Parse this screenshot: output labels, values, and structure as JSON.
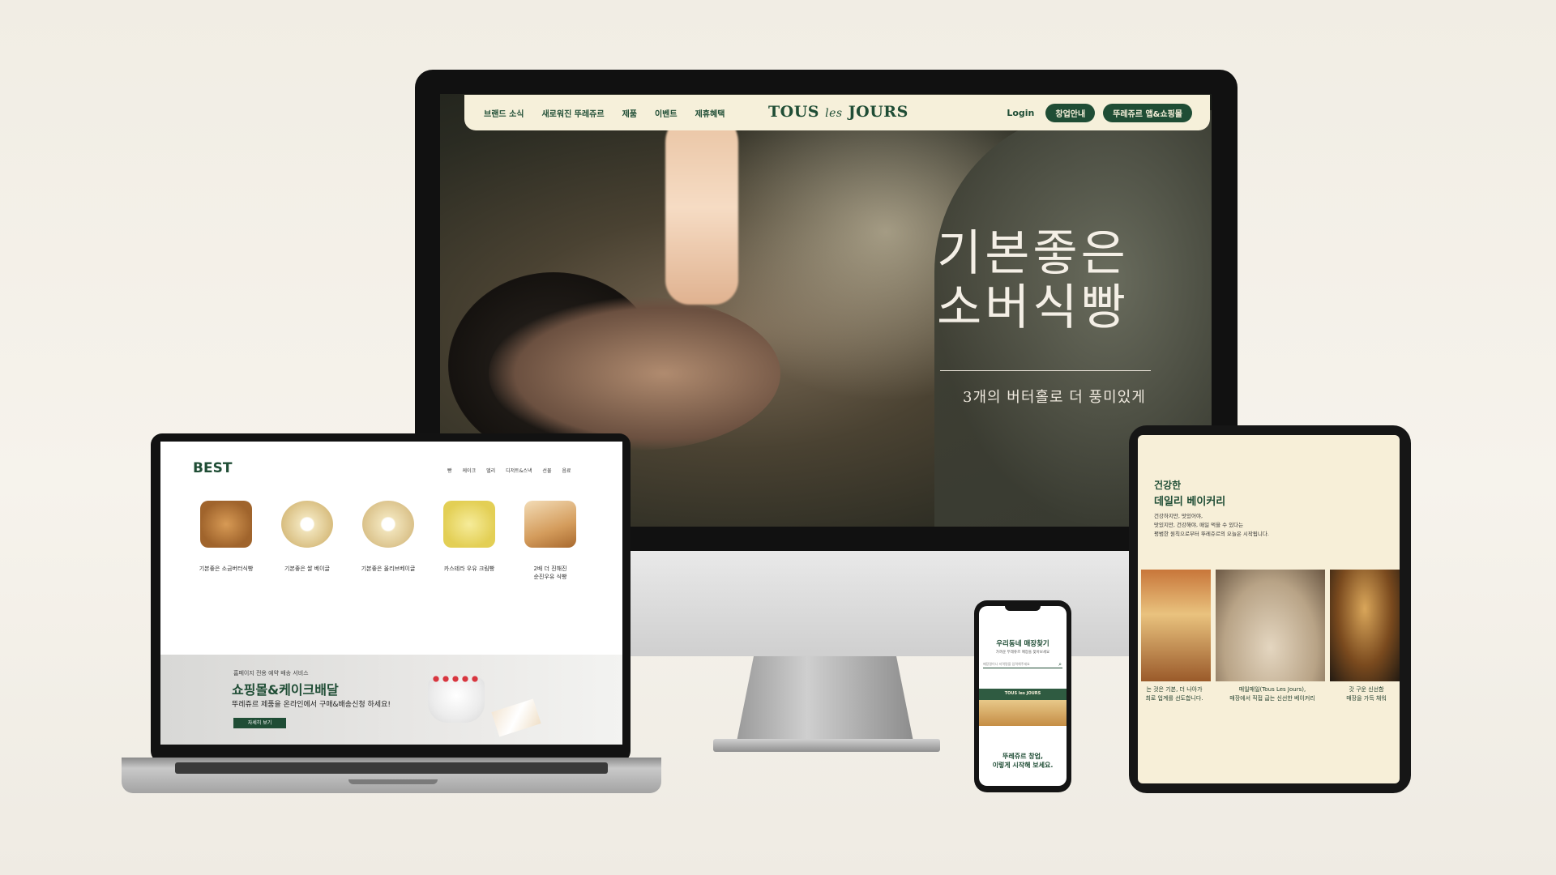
{
  "desktop": {
    "nav": {
      "links": [
        "브랜드 소식",
        "새로워진 뚜레쥬르",
        "제품",
        "이벤트",
        "제휴혜택"
      ],
      "logo_main": "TOUS",
      "logo_mid": "les",
      "logo_end": "JOURS",
      "login": "Login",
      "btn_franchise": "창업안내",
      "btn_app": "뚜레쥬르 앱&쇼핑몰"
    },
    "hero": {
      "title_line1": "기본좋은",
      "title_line2": "소버식빵",
      "subtitle": "3개의 버터홀로 더 풍미있게"
    }
  },
  "laptop": {
    "section_title": "BEST",
    "tabs": [
      "빵",
      "케이크",
      "델리",
      "디저트&스낵",
      "선물",
      "음료"
    ],
    "products": [
      {
        "name": "기본좋은 소금버터식빵",
        "icon": "bread-loaf-icon",
        "color": "#c98a47"
      },
      {
        "name": "기본좋은 쌀 베이글",
        "icon": "bagel-icon",
        "color": "#ecd9a6"
      },
      {
        "name": "기본좋은 올리브베이글",
        "icon": "olive-bagel-icon",
        "color": "#e7d4a4"
      },
      {
        "name": "카스테라 우유 크림빵",
        "icon": "cream-bread-icon",
        "color": "#f0e07a"
      },
      {
        "name": "2배 더 진해진\n순진우유 식빵",
        "icon": "milk-bread-icon",
        "color": "#e9c08c"
      }
    ],
    "banner": {
      "small": "홈페이지 전용 예약 배송 서비스",
      "title": "쇼핑몰&케이크배달",
      "desc": "뚜레쥬르 제품을 온라인에서 구매&배송신청 하세요!",
      "button": "자세히 보기"
    }
  },
  "tablet": {
    "title1": "건강한",
    "title2": "데일리 베이커리",
    "desc": "건강하지만, 맛있어야,\n맛있지만, 건강해야, 매일 먹을 수 있다는\n평범한 원칙으로부터 뚜레쥬르의 오늘은 시작됩니다.",
    "captions": [
      "는 것은 기본, 더 나아가\n최로 업계를 선도합니다.",
      "매일매일(Tous Les Jours),\n매장에서 직접 굽는 신선한 베이커리",
      "갓 구운 신선함\n매장을 가득 채워"
    ]
  },
  "phone": {
    "title": "우리동네 매장찾기",
    "sub": "가까운 뚜레쥬르 매장을 찾아보세요",
    "search_placeholder": "매장명이나 지역명을 입력해주세요",
    "store_sign": "TOUS les JOURS",
    "bottom_line1": "뚜레쥬르 창업,",
    "bottom_line2": "이렇게 시작해 보세요."
  },
  "colors": {
    "brand_green": "#1f4d35",
    "cream": "#f6f0da",
    "background": "#f1ede4"
  }
}
